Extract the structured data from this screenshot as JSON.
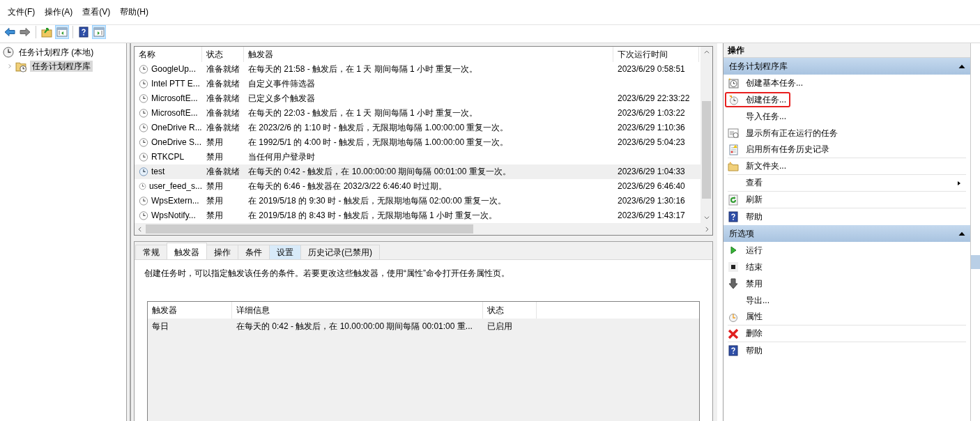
{
  "menu": [
    "文件(F)",
    "操作(A)",
    "查看(V)",
    "帮助(H)"
  ],
  "toolbar": [
    [
      {
        "kind": "back",
        "pressed": false
      },
      {
        "kind": "forward",
        "pressed": false
      }
    ],
    [
      {
        "kind": "up",
        "pressed": false
      },
      {
        "kind": "tree-toggle",
        "pressed": true
      }
    ],
    [
      {
        "kind": "help",
        "pressed": false
      },
      {
        "kind": "pane-toggle",
        "pressed": true
      }
    ]
  ],
  "tree": [
    {
      "label": "任务计划程序 (本地)",
      "selected": false,
      "children": [
        {
          "label": "任务计划程序库",
          "selected": true,
          "expanded": false
        }
      ]
    }
  ],
  "tasks": {
    "columns": [
      "名称",
      "状态",
      "触发器",
      "下次运行时间"
    ],
    "rows": [
      {
        "name": "GoogleUp...",
        "status": "准备就绪",
        "trigger": "在每天的 21:58 - 触发后，在 1 天 期间每隔 1 小时 重复一次。",
        "next_run": "2023/6/29 0:58:51",
        "selected": false
      },
      {
        "name": "Intel PTT E...",
        "status": "准备就绪",
        "trigger": "自定义事件筛选器",
        "next_run": "",
        "selected": false
      },
      {
        "name": "MicrosoftE...",
        "status": "准备就绪",
        "trigger": "已定义多个触发器",
        "next_run": "2023/6/29 22:33:22",
        "selected": false
      },
      {
        "name": "MicrosoftE...",
        "status": "准备就绪",
        "trigger": "在每天的 22:03 - 触发后，在 1 天 期间每隔 1 小时 重复一次。",
        "next_run": "2023/6/29 1:03:22",
        "selected": false
      },
      {
        "name": "OneDrive R...",
        "status": "准备就绪",
        "trigger": "在 2023/2/6 的 1:10 时 - 触发后，无限期地每隔 1.00:00:00 重复一次。",
        "next_run": "2023/6/29 1:10:36",
        "selected": false
      },
      {
        "name": "OneDrive S...",
        "status": "禁用",
        "trigger": "在 1992/5/1 的 4:00 时 - 触发后，无限期地每隔 1.00:00:00 重复一次。",
        "next_run": "2023/6/29 5:04:23",
        "selected": false
      },
      {
        "name": "RTKCPL",
        "status": "禁用",
        "trigger": "当任何用户登录时",
        "next_run": "",
        "selected": false
      },
      {
        "name": "test",
        "status": "准备就绪",
        "trigger": "在每天的 0:42 - 触发后，在 10.00:00:00 期间每隔 00:01:00 重复一次。",
        "next_run": "2023/6/29 1:04:33",
        "selected": true
      },
      {
        "name": "user_feed_s...",
        "status": "禁用",
        "trigger": "在每天的 6:46 - 触发器在 2032/3/22 6:46:40 时过期。",
        "next_run": "2023/6/29 6:46:40",
        "selected": false
      },
      {
        "name": "WpsExtern...",
        "status": "禁用",
        "trigger": "在 2019/5/18 的 9:30 时 - 触发后，无限期地每隔 02:00:00 重复一次。",
        "next_run": "2023/6/29 1:30:16",
        "selected": false
      },
      {
        "name": "WpsNotify...",
        "status": "禁用",
        "trigger": "在 2019/5/18 的 8:43 时 - 触发后，无限期地每隔 1 小时 重复一次。",
        "next_run": "2023/6/29 1:43:17",
        "selected": false
      }
    ]
  },
  "detail_tabs": [
    {
      "label": "常规",
      "selected": false,
      "hovered": false
    },
    {
      "label": "触发器",
      "selected": true,
      "hovered": false
    },
    {
      "label": "操作",
      "selected": false,
      "hovered": false
    },
    {
      "label": "条件",
      "selected": false,
      "hovered": false
    },
    {
      "label": "设置",
      "selected": false,
      "hovered": true
    },
    {
      "label": "历史记录(已禁用)",
      "selected": false,
      "hovered": false
    }
  ],
  "trigger_description": "创建任务时，可以指定触发该任务的条件。若要更改这些触发器，使用“属性”命令打开任务属性页。",
  "triggers": {
    "columns": [
      "触发器",
      "详细信息",
      "状态"
    ],
    "rows": [
      {
        "trigger": "每日",
        "details": "在每天的 0:42 - 触发后，在 10.00:00:00 期间每隔 00:01:00 重...",
        "status": "已启用"
      }
    ]
  },
  "actions": {
    "title": "操作",
    "sections": [
      {
        "title": "任务计划程序库",
        "items": [
          {
            "kind": "basic-task",
            "label": "创建基本任务...",
            "highlighted": false,
            "divider": false,
            "submenu": false
          },
          {
            "kind": "create-task",
            "label": "创建任务...",
            "highlighted": true,
            "divider": false,
            "submenu": false
          },
          {
            "kind": "none",
            "label": "导入任务...",
            "highlighted": false,
            "divider": false,
            "submenu": false
          },
          {
            "kind": "running",
            "label": "显示所有正在运行的任务",
            "highlighted": false,
            "divider": false,
            "submenu": false
          },
          {
            "kind": "history",
            "label": "启用所有任务历史记录",
            "highlighted": false,
            "divider": true,
            "submenu": false
          },
          {
            "kind": "folder",
            "label": "新文件夹...",
            "highlighted": false,
            "divider": true,
            "submenu": false
          },
          {
            "kind": "none",
            "label": "查看",
            "highlighted": false,
            "divider": true,
            "submenu": true
          },
          {
            "kind": "refresh",
            "label": "刷新",
            "highlighted": false,
            "divider": true,
            "submenu": false
          },
          {
            "kind": "help",
            "label": "帮助",
            "highlighted": false,
            "divider": false,
            "submenu": false
          }
        ]
      },
      {
        "title": "所选项",
        "items": [
          {
            "kind": "run",
            "label": "运行",
            "highlighted": false,
            "divider": false,
            "submenu": false
          },
          {
            "kind": "stop",
            "label": "结束",
            "highlighted": false,
            "divider": false,
            "submenu": false
          },
          {
            "kind": "disable",
            "label": "禁用",
            "highlighted": false,
            "divider": false,
            "submenu": false
          },
          {
            "kind": "none",
            "label": "导出...",
            "highlighted": false,
            "divider": false,
            "submenu": false
          },
          {
            "kind": "properties",
            "label": "属性",
            "highlighted": false,
            "divider": true,
            "submenu": false
          },
          {
            "kind": "delete",
            "label": "删除",
            "highlighted": false,
            "divider": true,
            "submenu": false
          },
          {
            "kind": "help",
            "label": "帮助",
            "highlighted": false,
            "divider": false,
            "submenu": false
          }
        ]
      }
    ]
  }
}
